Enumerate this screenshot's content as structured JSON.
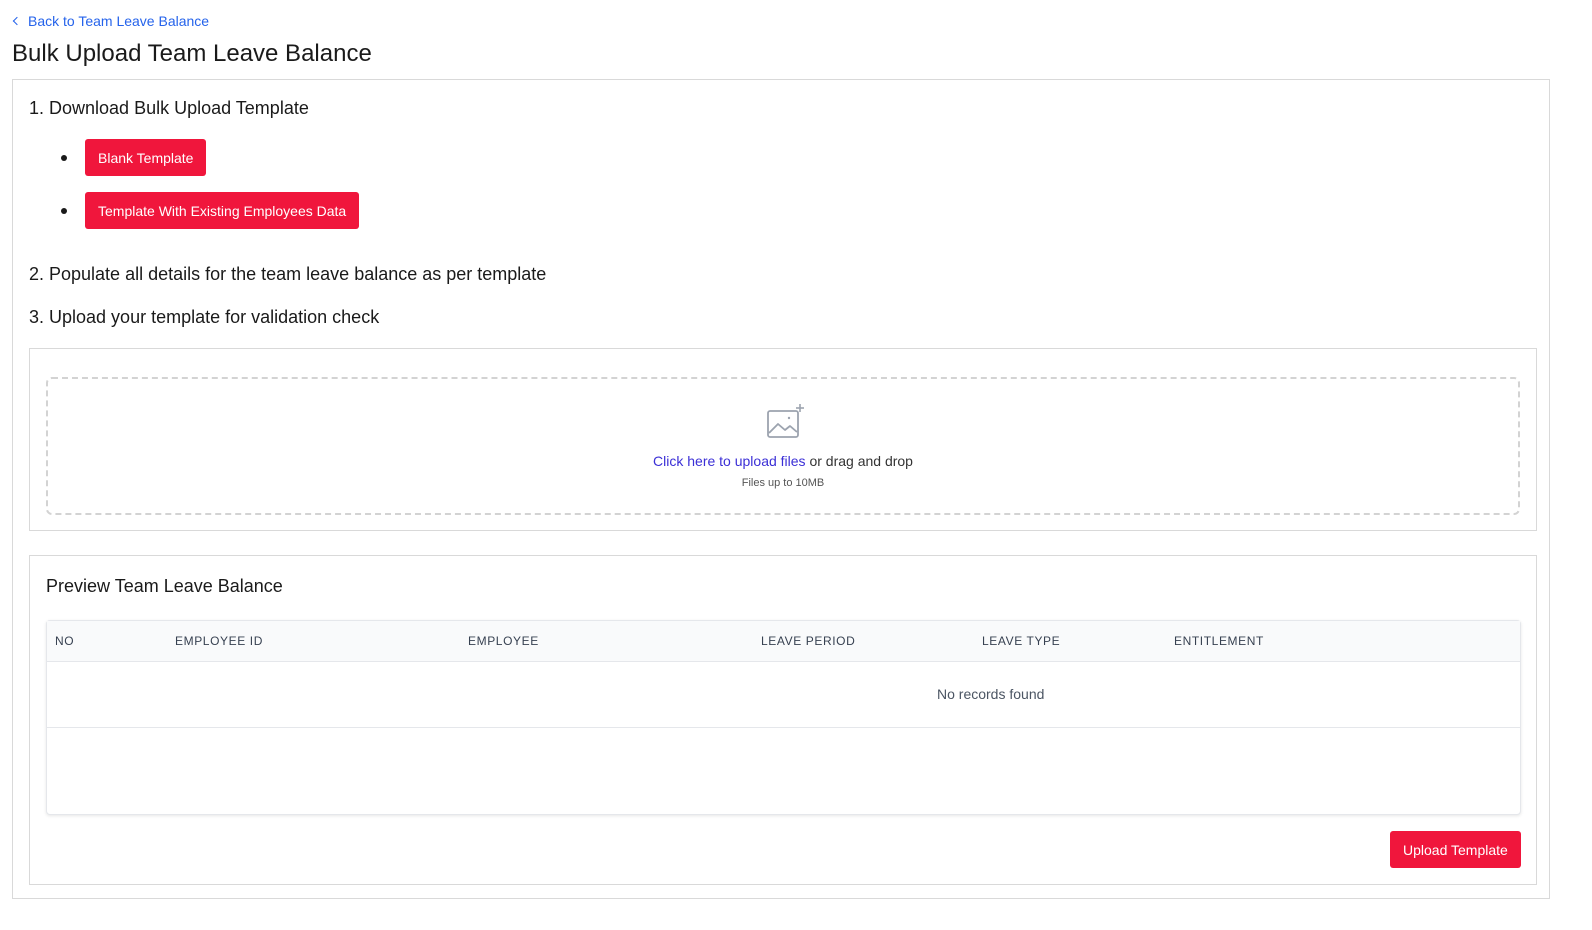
{
  "nav": {
    "back_label": "Back to Team Leave Balance"
  },
  "page": {
    "title": "Bulk Upload Team Leave Balance"
  },
  "steps": {
    "step1": "1. Download Bulk Upload Template",
    "step2": "2. Populate all details for the team leave balance as per template",
    "step3": "3. Upload your template for validation check"
  },
  "templates": {
    "blank_label": "Blank Template",
    "existing_label": "Template With Existing Employees Data"
  },
  "dropzone": {
    "link_text": "Click here to upload files",
    "rest_text": " or drag and drop",
    "size_hint": "Files up to 10MB",
    "icon": "image-upload-icon"
  },
  "preview": {
    "title": "Preview Team Leave Balance",
    "columns": [
      "NO",
      "EMPLOYEE ID",
      "EMPLOYEE",
      "LEAVE PERIOD",
      "LEAVE TYPE",
      "ENTITLEMENT"
    ],
    "empty_text": "No records found"
  },
  "actions": {
    "upload_label": "Upload Template"
  },
  "colors": {
    "primary": "#f0163c",
    "link": "#2563eb",
    "upload_link": "#3b2fd6"
  }
}
